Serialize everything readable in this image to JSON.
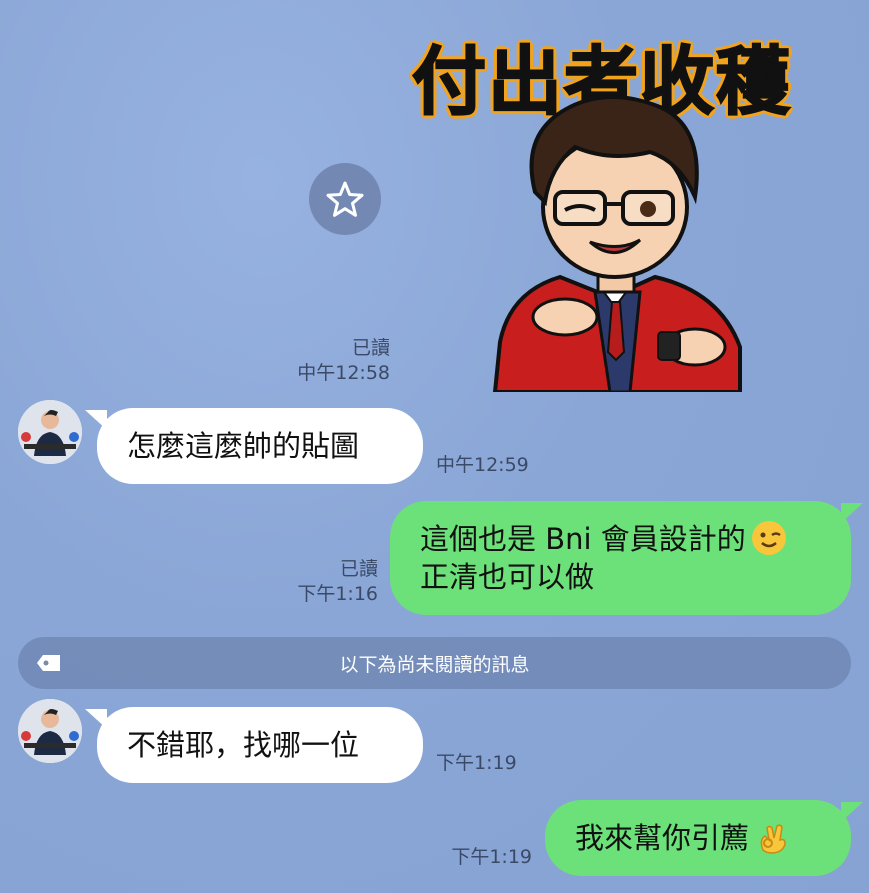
{
  "sticker": {
    "caption": "付出者收穫",
    "icon": "boy-character-sticker"
  },
  "favorite_icon": "star-icon",
  "messages": [
    {
      "id": "m1",
      "type": "sticker",
      "side": "out",
      "read": "已讀",
      "time": "中午12:58"
    },
    {
      "id": "m2",
      "type": "text",
      "side": "in",
      "text": "怎麼這麼帥的貼圖",
      "time": "中午12:59"
    },
    {
      "id": "m3",
      "type": "text",
      "side": "out",
      "lines": [
        "這個也是 Bni 會員設計的",
        "正清也可以做"
      ],
      "emoji": "winking-face",
      "read": "已讀",
      "time": "下午1:16"
    },
    {
      "id": "m4",
      "type": "text",
      "side": "in",
      "text": "不錯耶，找哪一位",
      "time": "下午1:19"
    },
    {
      "id": "m5",
      "type": "text",
      "side": "out",
      "text": "我來幫你引薦",
      "emoji": "ok-hand",
      "time": "下午1:19"
    }
  ],
  "unread_divider": {
    "label": "以下為尚未閱讀的訊息",
    "icon": "tag-icon"
  },
  "colors": {
    "background": "#8ca8d8",
    "outgoing": "#6ce079",
    "incoming": "#ffffff",
    "sticker_outline": "#f2a31c"
  }
}
